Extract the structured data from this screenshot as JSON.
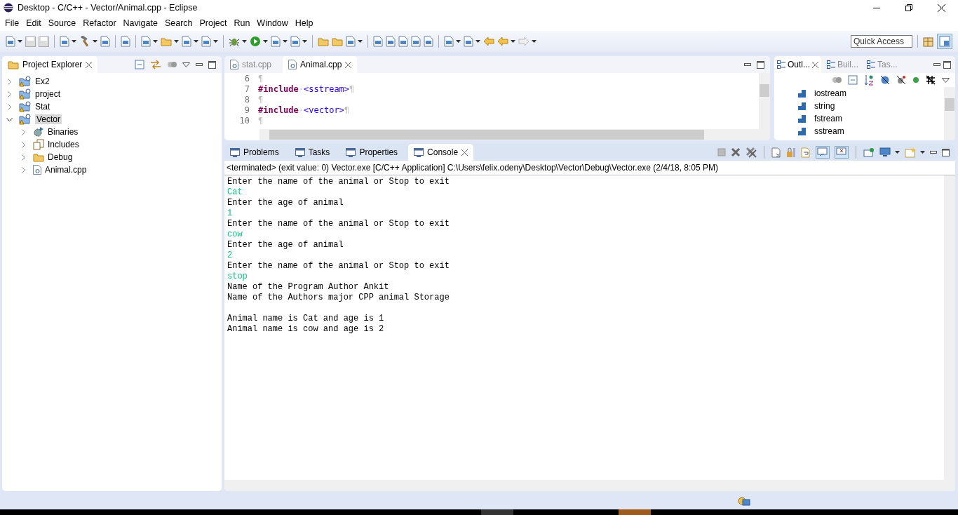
{
  "window": {
    "title": "Desktop - C/C++ - Vector/Animal.cpp - Eclipse"
  },
  "menu": [
    "File",
    "Edit",
    "Source",
    "Refactor",
    "Navigate",
    "Search",
    "Project",
    "Run",
    "Window",
    "Help"
  ],
  "quick_access": {
    "placeholder": "Quick Access"
  },
  "project_explorer": {
    "title": "Project Explorer",
    "items": [
      {
        "label": "Ex2",
        "kind": "project",
        "expanded": false,
        "selected": false
      },
      {
        "label": "project",
        "kind": "project",
        "expanded": false,
        "selected": false
      },
      {
        "label": "Stat",
        "kind": "project",
        "expanded": false,
        "selected": false
      },
      {
        "label": "Vector",
        "kind": "project",
        "expanded": true,
        "selected": true,
        "children": [
          {
            "label": "Binaries",
            "kind": "binaries",
            "expanded": false,
            "selected": false
          },
          {
            "label": "Includes",
            "kind": "includes",
            "expanded": false,
            "selected": false
          },
          {
            "label": "Debug",
            "kind": "folder",
            "expanded": false,
            "selected": false
          },
          {
            "label": "Animal.cpp",
            "kind": "file",
            "expanded": false,
            "selected": false
          }
        ]
      }
    ]
  },
  "editor": {
    "tabs": [
      {
        "label": "stat.cpp",
        "selected": false
      },
      {
        "label": "Animal.cpp",
        "selected": true
      }
    ],
    "lines": [
      {
        "number": "6",
        "segments": [
          {
            "text": "¶",
            "kind": "mark"
          }
        ]
      },
      {
        "number": "7",
        "segments": [
          {
            "text": "#include",
            "kind": "keyword"
          },
          {
            "text": "·",
            "kind": "mark"
          },
          {
            "text": "<sstream>",
            "kind": "header"
          },
          {
            "text": "¶",
            "kind": "mark"
          }
        ]
      },
      {
        "number": "8",
        "segments": [
          {
            "text": "¶",
            "kind": "mark"
          }
        ]
      },
      {
        "number": "9",
        "segments": [
          {
            "text": "#include",
            "kind": "keyword"
          },
          {
            "text": "·",
            "kind": "mark"
          },
          {
            "text": "<vector>",
            "kind": "header"
          },
          {
            "text": "¶",
            "kind": "mark"
          }
        ]
      },
      {
        "number": "10",
        "segments": [
          {
            "text": "¶",
            "kind": "mark"
          }
        ]
      }
    ]
  },
  "outline": {
    "tabs": [
      {
        "label": "Outl...",
        "selected": true
      },
      {
        "label": "Buil...",
        "selected": false
      },
      {
        "label": "Tas...",
        "selected": false
      }
    ],
    "items": [
      "iostream",
      "string",
      "fstream",
      "sstream"
    ]
  },
  "console": {
    "tabs": [
      {
        "label": "Problems",
        "selected": false
      },
      {
        "label": "Tasks",
        "selected": false
      },
      {
        "label": "Properties",
        "selected": false
      },
      {
        "label": "Console",
        "selected": true
      }
    ],
    "header": "<terminated> (exit value: 0) Vector.exe [C/C++ Application] C:\\Users\\felix.odeny\\Desktop\\Vector\\Debug\\Vector.exe (2/4/18, 8:05 PM)",
    "lines": [
      {
        "text": "Enter the name of the animal or Stop to exit",
        "kind": "output"
      },
      {
        "text": "Cat",
        "kind": "input"
      },
      {
        "text": "Enter the age of animal",
        "kind": "output"
      },
      {
        "text": "1",
        "kind": "input"
      },
      {
        "text": "Enter the name of the animal or Stop to exit",
        "kind": "output"
      },
      {
        "text": "cow",
        "kind": "input"
      },
      {
        "text": "Enter the age of animal",
        "kind": "output"
      },
      {
        "text": "2",
        "kind": "input"
      },
      {
        "text": "Enter the name of the animal or Stop to exit",
        "kind": "output"
      },
      {
        "text": "stop",
        "kind": "input"
      },
      {
        "text": "Name of the Program Author Ankit",
        "kind": "output"
      },
      {
        "text": "Name of the Authors major CPP animal Storage",
        "kind": "output"
      },
      {
        "kind": "blank"
      },
      {
        "text": "Animal name is Cat and age is 1",
        "kind": "output"
      },
      {
        "text": "Animal name is cow and age is 2",
        "kind": "output"
      }
    ]
  }
}
